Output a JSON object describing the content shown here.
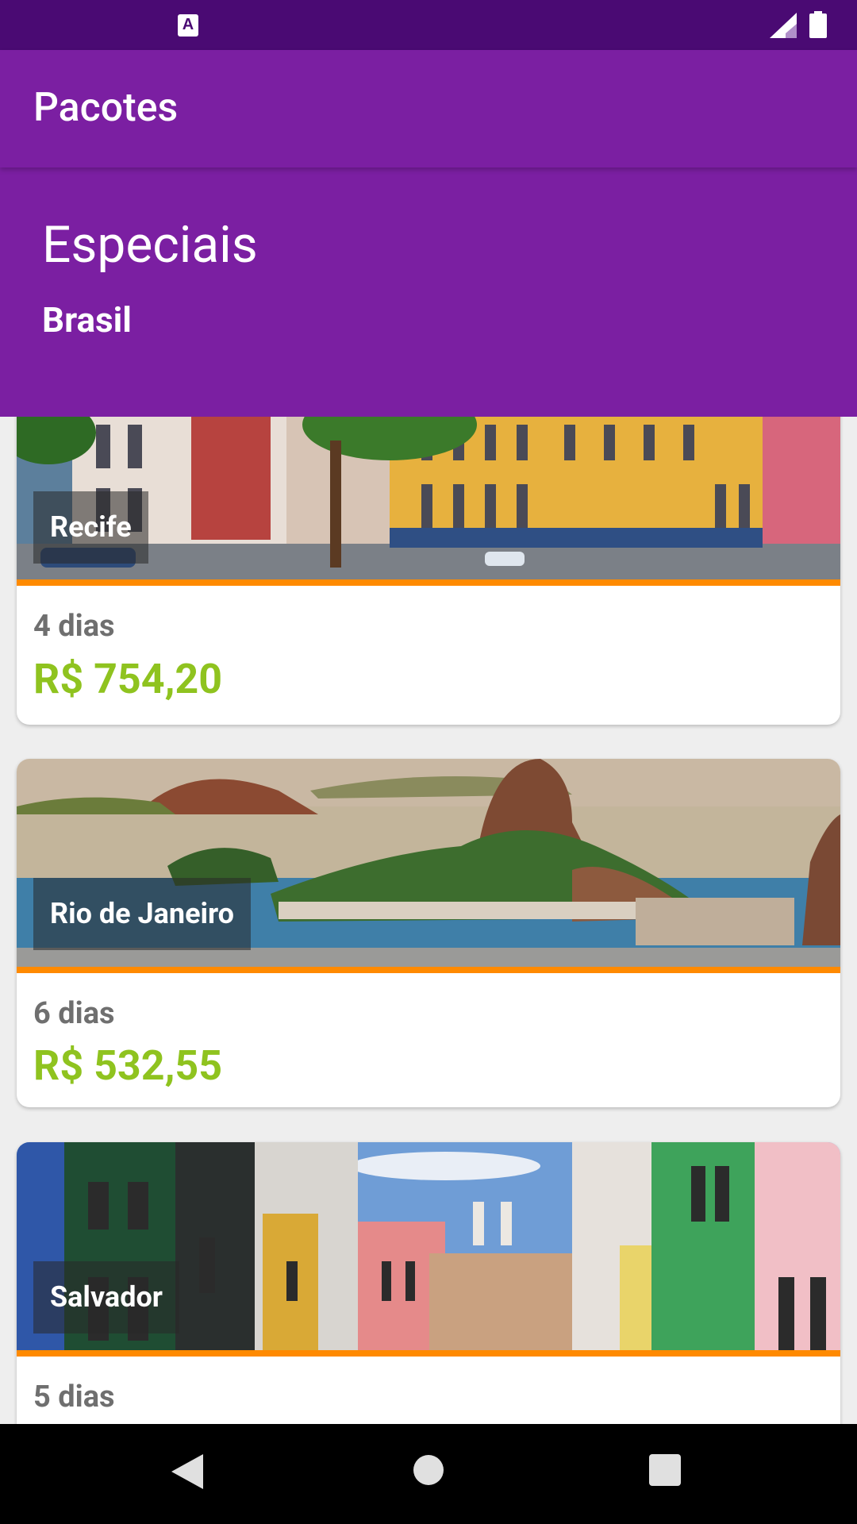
{
  "status_bar": {
    "notification_icon": "a-accessibility-icon",
    "signal_icon": "cellular-signal-icon",
    "battery_icon": "battery-full-icon"
  },
  "app_bar": {
    "title": "Pacotes"
  },
  "header": {
    "title": "Especiais",
    "subtitle": "Brasil"
  },
  "packages": [
    {
      "place": "Recife",
      "days": "4 dias",
      "price": "R$ 754,20"
    },
    {
      "place": "Rio de Janeiro",
      "days": "6 dias",
      "price": "R$ 532,55"
    },
    {
      "place": "Salvador",
      "days": "5 dias",
      "price": ""
    }
  ],
  "navigation": {
    "back_icon": "back-triangle-icon",
    "home_icon": "home-circle-icon",
    "recents_icon": "recents-square-icon"
  },
  "colors": {
    "status_bar": "#4a0a73",
    "primary": "#7b1fa2",
    "price": "#8fc31f",
    "accent_stripe": "#ff8a00"
  }
}
